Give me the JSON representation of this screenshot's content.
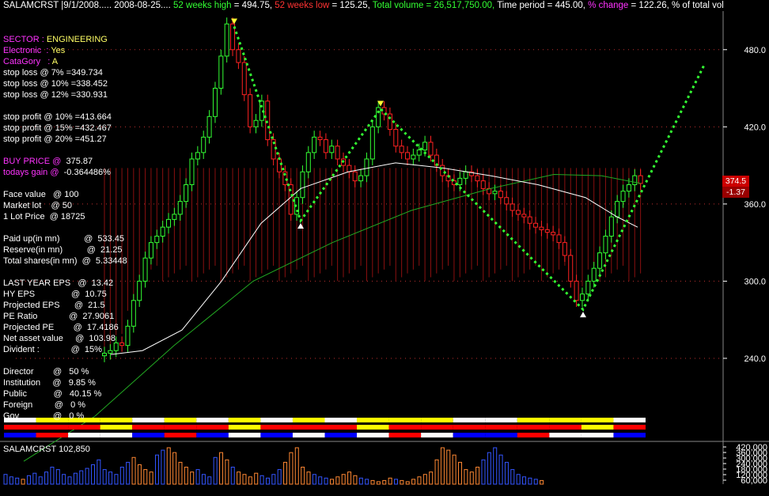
{
  "header": {
    "symbol": "SALAMCRST",
    "date": "9/1/2008..... 2008-08-25....",
    "w52_high_label": "52 weeks high",
    "w52_high": "= 494.75,",
    "w52_low_label": "52 weeks low",
    "w52_low": "= 125.25,",
    "total_volume": "Total volume = 26,517,750.00,",
    "time_period": "Time period = 445.00,",
    "pct_change_label": "% change",
    "pct_change": "= 122.26,",
    "tail": "% of total vol"
  },
  "info": {
    "sector_label": "SECTOR :",
    "sector": "ENGINEERING",
    "electronic_label": "Electronic  :",
    "electronic": "Yes",
    "category_label": "CataGory   :",
    "category": "A",
    "stop_loss": [
      "stop loss @ 7% =349.734",
      "stop loss @ 10% =338.452",
      "stop loss @ 12% =330.931"
    ],
    "stop_profit": [
      "stop profit @ 10% =413.664",
      "stop profit @ 15% =432.467",
      "stop profit @ 20% =451.27"
    ],
    "buy_price_label": "BUY PRICE @",
    "buy_price": "375.87",
    "todays_gain_label": "todays gain @",
    "todays_gain": "-0.364486%",
    "face_value": "Face value   @ 100",
    "market_lot": "Market lot    @ 50",
    "lot_price": "1 Lot Price  @ 18725",
    "paid_up": "Paid up(in mn)          @  533.45",
    "reserve": "Reserve(in mn)          @  21.25",
    "total_shares": "Total shares(in mn)  @  5.33448",
    "last_eps": "LAST YEAR EPS   @  13.42",
    "hy_eps": "HY EPS               @  10.75",
    "proj_eps": "Projected EPS      @  21.5",
    "pe_ratio": "PE Ratio             @  27.9061",
    "proj_pe": "Projected PE        @  17.4186",
    "nav": "Net asset value     @  103.98",
    "divident": "Divident :             @  15%",
    "director": "Director        @   50 %",
    "institution": "Institution     @   9.85 %",
    "public": "Public           @   40.15 %",
    "foreign": "Foreign         @   0 %",
    "gov": "Gov              @   0 %"
  },
  "price_tag": {
    "price": "374.5",
    "change": "-1.37"
  },
  "volume_panel": {
    "label": "SALAMCRST 102,850"
  },
  "colors": {
    "up": "#33ff33",
    "down": "#ff2222",
    "trend": "#33ff33",
    "ma_short": "#ffffff",
    "ma_long": "#22aa22"
  },
  "chart_data": {
    "type": "candlestick",
    "ylim": [
      200,
      510
    ],
    "y_ticks": [
      "480.0",
      "420.0",
      "360.0",
      "300.0",
      "240.0"
    ],
    "y_tick_values": [
      480,
      420,
      360,
      300,
      240
    ],
    "volume_ticks": [
      "420,000",
      "360,000",
      "300,000",
      "240,000",
      "180,000",
      "120,000",
      "60,000"
    ],
    "closes": [
      244,
      246,
      252,
      250,
      265,
      285,
      300,
      318,
      330,
      335,
      342,
      348,
      352,
      362,
      375,
      395,
      400,
      412,
      428,
      450,
      475,
      500,
      480,
      470,
      445,
      420,
      425,
      440,
      410,
      395,
      385,
      375,
      352,
      365,
      385,
      400,
      412,
      410,
      400,
      405,
      395,
      390,
      385,
      378,
      382,
      395,
      420,
      435,
      430,
      418,
      405,
      400,
      395,
      398,
      402,
      408,
      398,
      390,
      382,
      378,
      375,
      380,
      385,
      382,
      378,
      372,
      368,
      370,
      365,
      360,
      355,
      352,
      350,
      345,
      342,
      340,
      338,
      336,
      330,
      320,
      300,
      285,
      290,
      300,
      310,
      322,
      335,
      350,
      362,
      370,
      375,
      382,
      376
    ],
    "trend_points": [
      [
        296,
        498
      ],
      [
        380,
        347
      ],
      [
        481,
        434
      ],
      [
        737,
        278
      ],
      [
        890,
        468
      ]
    ],
    "ma_short": [
      [
        140,
        243
      ],
      [
        180,
        246
      ],
      [
        230,
        262
      ],
      [
        280,
        300
      ],
      [
        330,
        345
      ],
      [
        380,
        372
      ],
      [
        440,
        385
      ],
      [
        500,
        392
      ],
      [
        560,
        388
      ],
      [
        620,
        382
      ],
      [
        680,
        375
      ],
      [
        740,
        365
      ],
      [
        780,
        350
      ],
      [
        806,
        342
      ]
    ],
    "ma_long": [
      [
        30,
        160
      ],
      [
        120,
        195
      ],
      [
        220,
        250
      ],
      [
        320,
        300
      ],
      [
        420,
        330
      ],
      [
        520,
        355
      ],
      [
        620,
        372
      ],
      [
        700,
        383
      ],
      [
        760,
        382
      ],
      [
        810,
        376
      ]
    ],
    "volume": [
      8,
      6,
      5,
      4,
      7,
      9,
      6,
      10,
      14,
      12,
      8,
      6,
      9,
      11,
      13,
      16,
      20,
      12,
      10,
      8,
      14,
      18,
      22,
      16,
      12,
      10,
      24,
      28,
      30,
      26,
      18,
      14,
      10,
      12,
      8,
      6,
      22,
      26,
      20,
      14,
      10,
      8,
      6,
      9,
      7,
      5,
      8,
      12,
      18,
      26,
      30,
      14,
      10,
      8,
      6,
      5,
      4,
      6,
      8,
      10,
      7,
      5,
      4,
      3,
      2,
      3,
      5,
      4,
      3,
      2,
      4,
      6,
      8,
      10,
      20,
      30,
      28,
      24,
      18,
      12,
      10,
      14,
      20,
      26,
      30,
      24,
      18,
      12,
      8,
      6,
      5,
      4,
      3
    ]
  }
}
